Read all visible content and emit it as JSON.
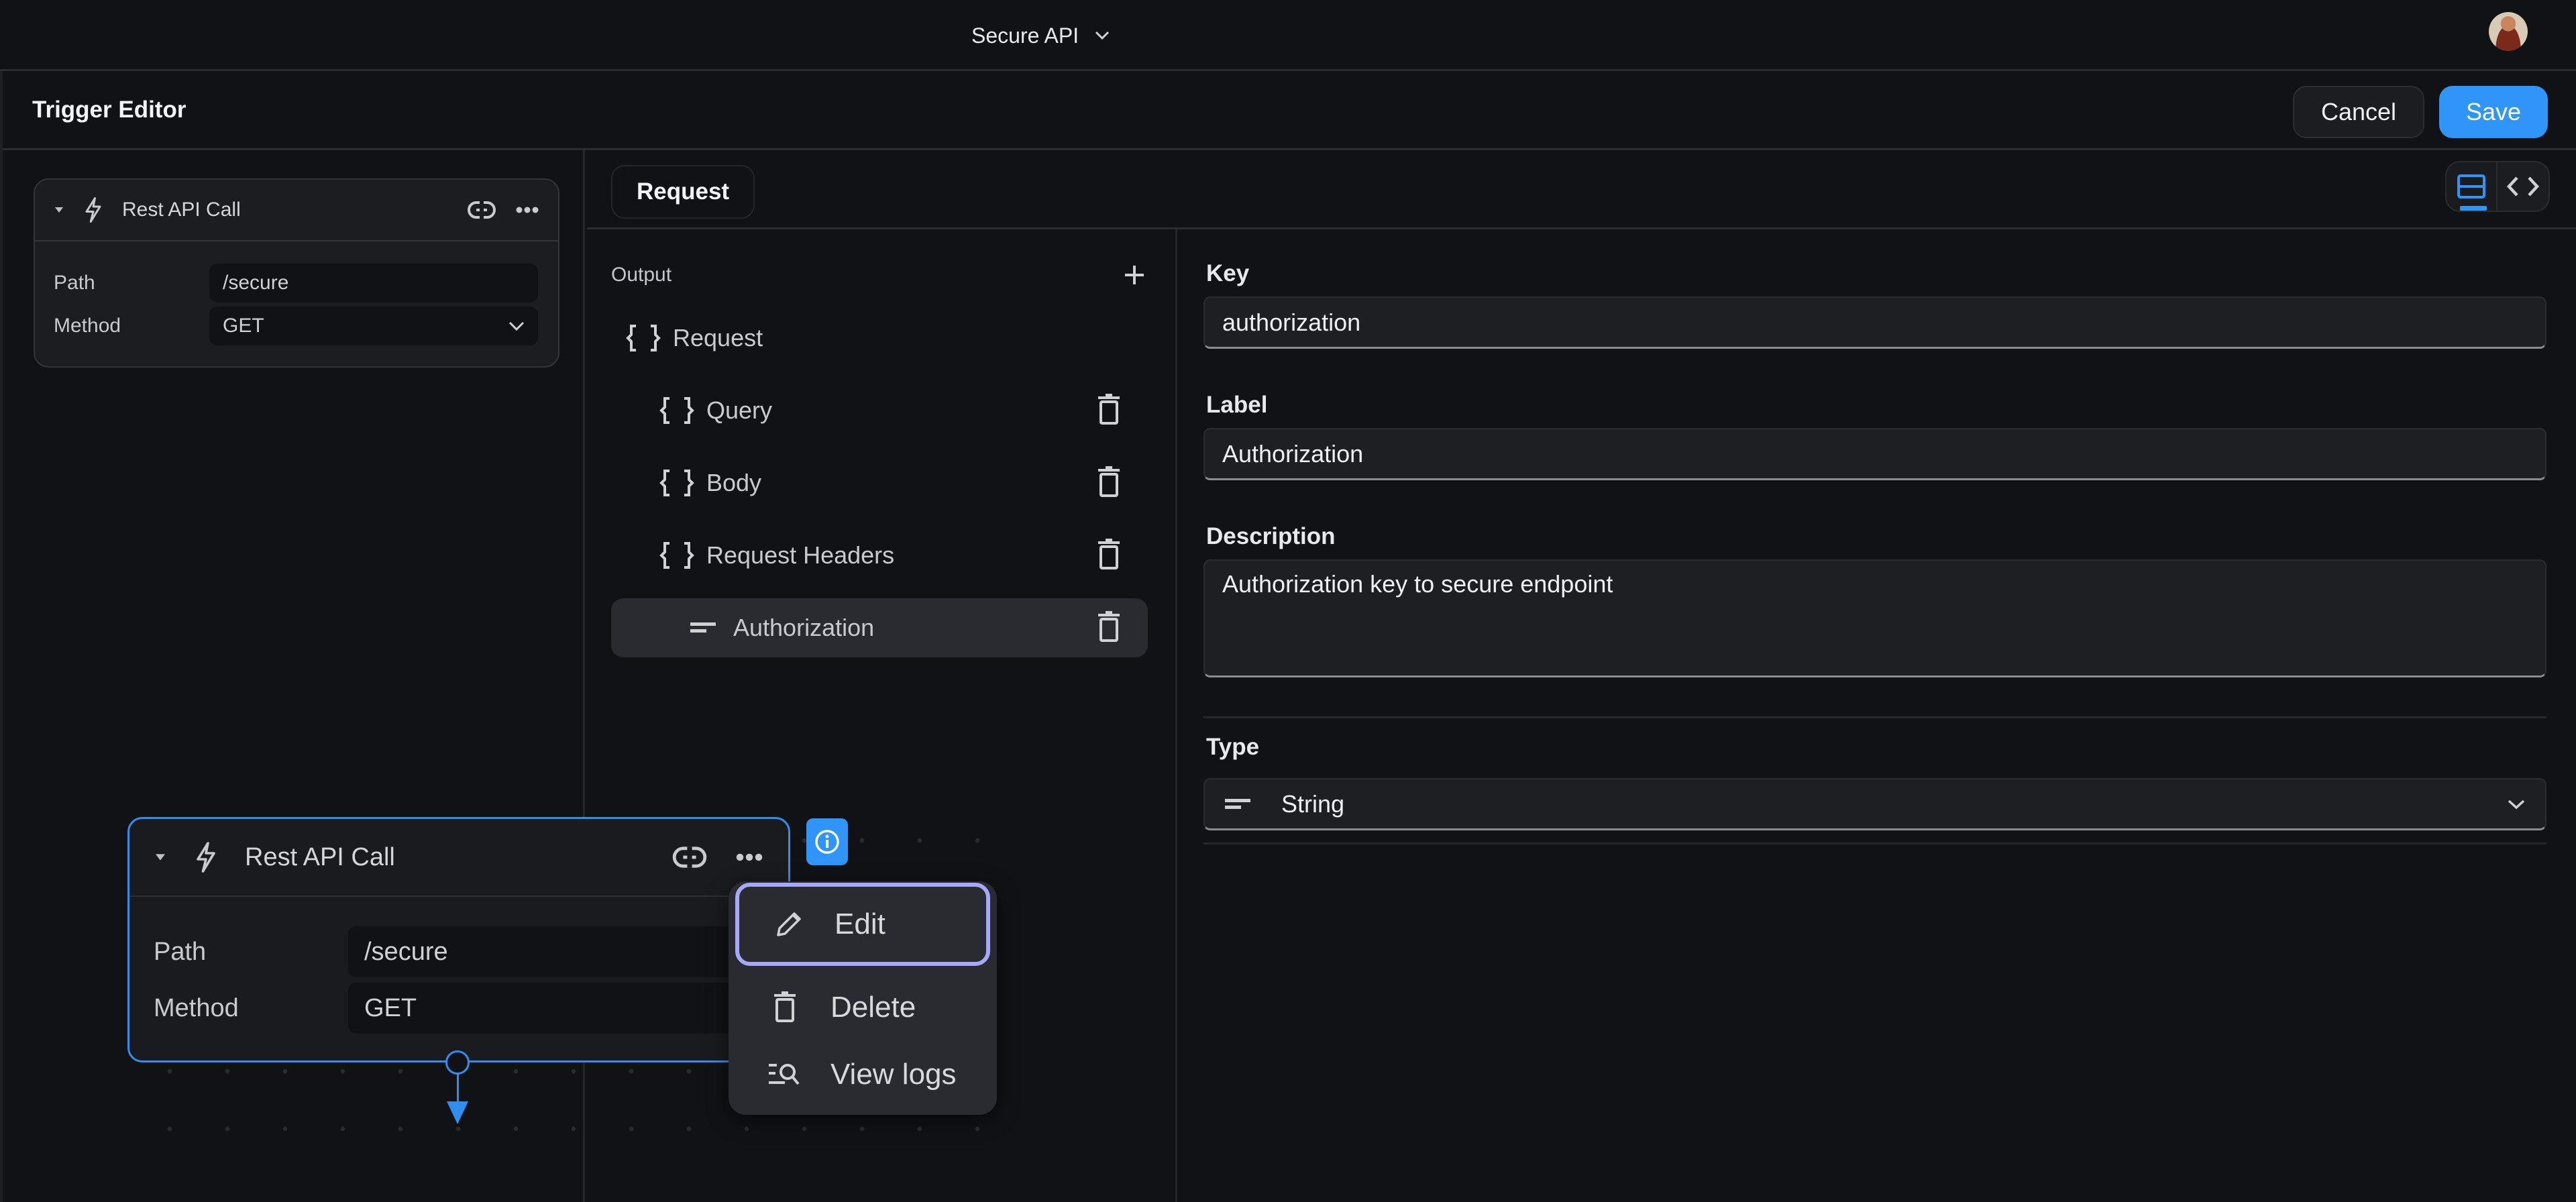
{
  "topbar": {
    "project_name": "Secure API",
    "project_chevron_icon": "chevron-down-icon",
    "avatar_icon": "user-avatar"
  },
  "editor": {
    "title": "Trigger Editor",
    "cancel_label": "Cancel",
    "save_label": "Save"
  },
  "mini_node": {
    "title": "Rest API Call",
    "icons": [
      "caret-down-icon",
      "lightning-icon",
      "link-icon",
      "more-icon"
    ],
    "fields": [
      {
        "label": "Path",
        "value": "/secure"
      },
      {
        "label": "Method",
        "value": "GET"
      }
    ]
  },
  "tabs": {
    "items": [
      {
        "label": "Request",
        "active": true
      }
    ],
    "view_toggle": [
      {
        "icon": "form-view-icon",
        "active": true
      },
      {
        "icon": "code-view-icon",
        "active": false
      }
    ]
  },
  "output": {
    "title": "Output",
    "add_icon": "plus-icon",
    "items": [
      {
        "label": "Request",
        "icon": "braces-icon",
        "depth": 0,
        "deletable": false,
        "selected": false
      },
      {
        "label": "Query",
        "icon": "braces-icon",
        "depth": 1,
        "deletable": true,
        "selected": false
      },
      {
        "label": "Body",
        "icon": "braces-icon",
        "depth": 1,
        "deletable": true,
        "selected": false
      },
      {
        "label": "Request Headers",
        "icon": "braces-icon",
        "depth": 1,
        "deletable": true,
        "selected": false
      },
      {
        "label": "Authorization",
        "icon": "string-type-icon",
        "depth": 2,
        "deletable": true,
        "selected": true
      }
    ]
  },
  "form": {
    "key": {
      "label": "Key",
      "value": "authorization"
    },
    "label": {
      "label": "Label",
      "value": "Authorization"
    },
    "description": {
      "label": "Description",
      "value": "Authorization key to secure endpoint"
    },
    "type": {
      "label": "Type",
      "value": "String",
      "icon": "string-type-icon"
    }
  },
  "main_node": {
    "title": "Rest API Call",
    "fields": [
      {
        "label": "Path",
        "value": "/secure"
      },
      {
        "label": "Method",
        "value": "GET"
      }
    ],
    "accent": "#2f8ff0"
  },
  "context_menu": {
    "items": [
      {
        "label": "Edit",
        "icon": "pencil-icon",
        "focused": true
      },
      {
        "label": "Delete",
        "icon": "trash-icon",
        "focused": false
      },
      {
        "label": "View logs",
        "icon": "search-logs-icon",
        "focused": false
      }
    ]
  },
  "colors": {
    "accent": "#2f95f8",
    "focus_ring": "#a5a8fb",
    "background": "#111216",
    "surface": "#1c1d21"
  }
}
